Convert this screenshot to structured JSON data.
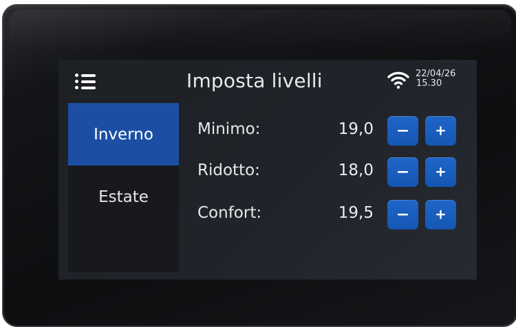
{
  "screen": {
    "title": "Imposta livelli",
    "date": "22/04/26",
    "time": "15.30"
  },
  "sidebar": {
    "items": [
      {
        "label": "Inverno",
        "active": true
      },
      {
        "label": "Estate",
        "active": false
      }
    ]
  },
  "levels": [
    {
      "label": "Minimo:",
      "value": "19,0"
    },
    {
      "label": "Ridotto:",
      "value": "18,0"
    },
    {
      "label": "Confort:",
      "value": "19,5"
    }
  ],
  "icons": {
    "menu": "menu-list-icon",
    "wifi": "wifi-icon",
    "decrease": "minus-icon",
    "increase": "plus-icon"
  },
  "colors": {
    "accent": "#1c4fa3",
    "button": "#1a5fc0",
    "screen_bg": "#1f2227",
    "bezel": "#0f1012"
  }
}
